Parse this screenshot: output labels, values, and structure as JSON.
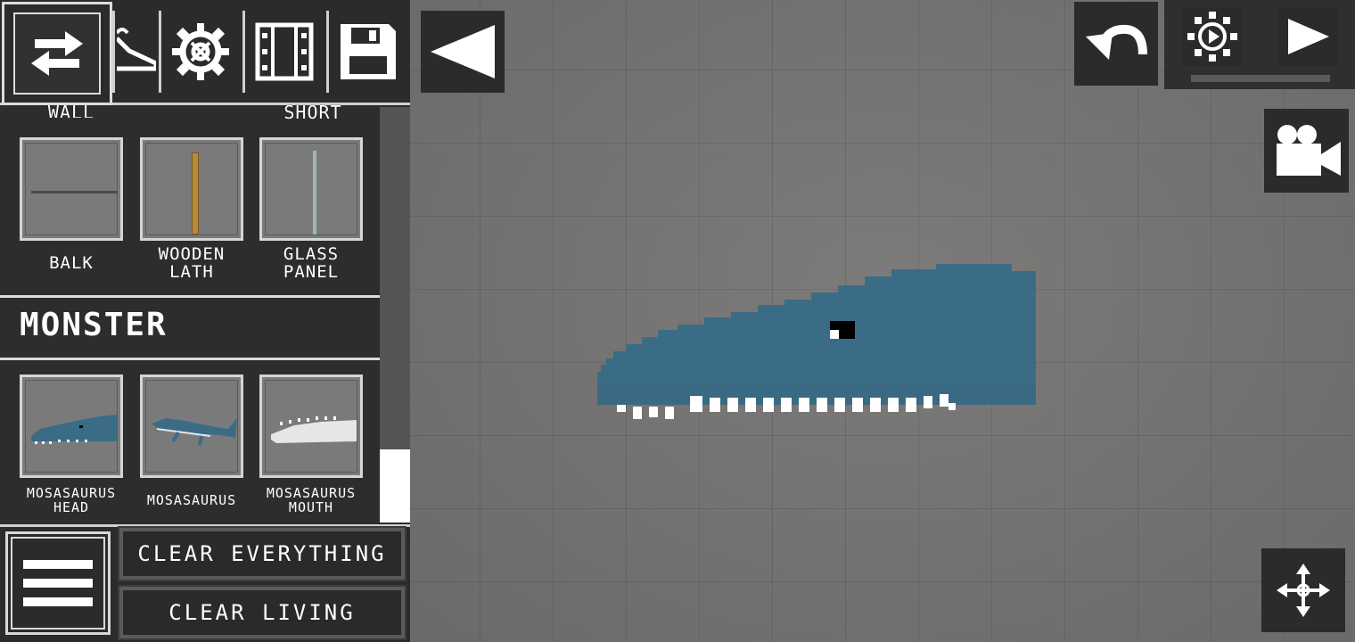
{
  "toolbar": {
    "switch_icon": "swap-arrows-icon",
    "tools": [
      {
        "icon": "hanger-icon"
      },
      {
        "icon": "gear-icon"
      },
      {
        "icon": "film-strip-icon"
      },
      {
        "icon": "floppy-disk-icon"
      }
    ],
    "collapse_icon": "triangle-left-icon"
  },
  "catalog": {
    "partial_labels": [
      "WALL",
      "SHORT"
    ],
    "building_items": [
      {
        "label_line1": "BALK",
        "label_line2": ""
      },
      {
        "label_line1": "WOODEN",
        "label_line2": "LATH"
      },
      {
        "label_line1": "GLASS",
        "label_line2": "PANEL"
      }
    ],
    "category_title": "MONSTER",
    "monster_items": [
      {
        "label_line1": "MOSASAURUS",
        "label_line2": "HEAD"
      },
      {
        "label_line1": "MOSASAURUS",
        "label_line2": ""
      },
      {
        "label_line1": "MOSASAURUS",
        "label_line2": "MOUTH"
      }
    ]
  },
  "bottom": {
    "clear_everything": "CLEAR EVERYTHING",
    "clear_living": "CLEAR LIVING"
  },
  "hud": {
    "undo_icon": "undo-arrow-icon",
    "slow_motion_icon": "slow-motion-icon",
    "play_icon": "play-icon",
    "camera_icon": "camera-icon",
    "move_icon": "move-arrows-icon"
  },
  "colors": {
    "creature_body": "#3d6d86",
    "creature_outline": "#356078",
    "teeth": "#ffffff",
    "eye": "#000000"
  }
}
